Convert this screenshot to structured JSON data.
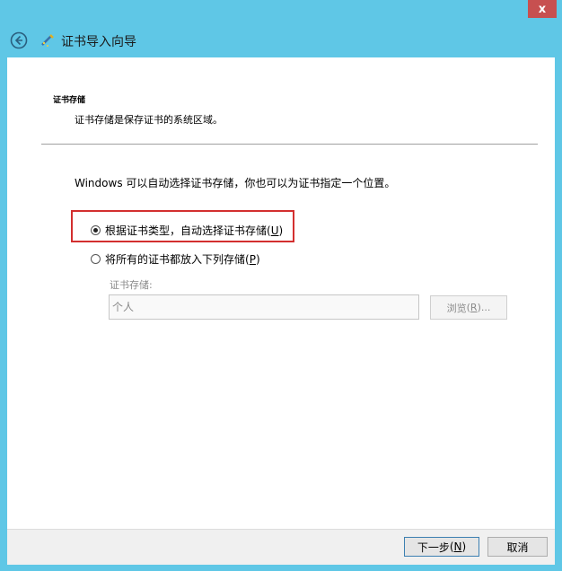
{
  "window": {
    "title": "证书导入向导",
    "close_label": "x"
  },
  "section": {
    "title": "证书存储",
    "description": "证书存储是保存证书的系统区域。"
  },
  "intro_text": "Windows 可以自动选择证书存储，你也可以为证书指定一个位置。",
  "options": [
    {
      "label": "根据证书类型，自动选择证书存储",
      "hotkey": "U",
      "selected": true
    },
    {
      "label": "将所有的证书都放入下列存储",
      "hotkey": "P",
      "selected": false
    }
  ],
  "store": {
    "label": "证书存储:",
    "value": "个人",
    "browse_label": "浏览",
    "browse_hotkey": "R",
    "browse_suffix": "..."
  },
  "footer": {
    "next_label": "下一步",
    "next_hotkey": "N",
    "cancel_label": "取消"
  },
  "colors": {
    "titlebar": "#5fc7e6",
    "close": "#c75050",
    "highlight": "#d32f2f"
  }
}
